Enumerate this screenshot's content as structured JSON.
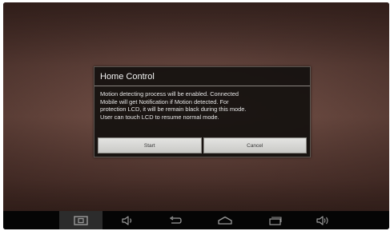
{
  "dialog": {
    "title": "Home Control",
    "message_lines": [
      "Motion detecting process will be enabled. Connected",
      "Mobile will get Notification if Motion detected. For",
      "protection LCD, it will be remain black during this mode.",
      "User can touch LCD to resume normal mode."
    ],
    "start_label": "Start",
    "cancel_label": "Cancel"
  },
  "navbar": {
    "icons": [
      "screenshot-icon",
      "volume-down-icon",
      "back-icon",
      "home-icon",
      "recent-apps-icon",
      "volume-up-icon"
    ],
    "active": "screenshot-icon"
  },
  "colors": {
    "dialog_bg": "#14110f",
    "button_bg": "#d8d8d6",
    "wallpaper": "#6a4a42",
    "navbar_bg": "#050505",
    "nav_icon": "#9a9a9a"
  }
}
